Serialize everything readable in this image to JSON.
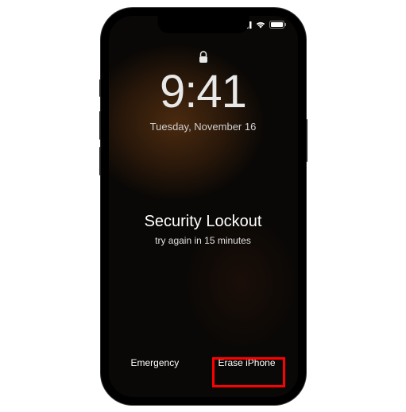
{
  "status": {
    "time": "9:41",
    "date": "Tuesday, November 16"
  },
  "lockout": {
    "title": "Security Lockout",
    "subtitle": "try again in 15 minutes"
  },
  "buttons": {
    "emergency": "Emergency",
    "erase": "Erase iPhone"
  }
}
